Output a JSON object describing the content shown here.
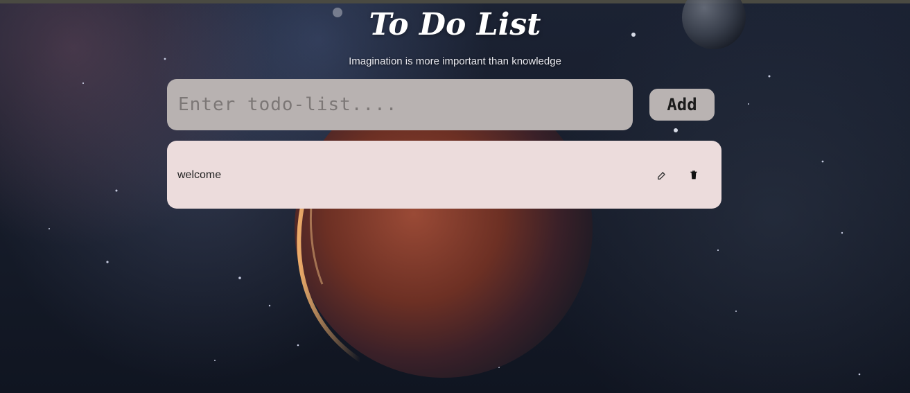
{
  "header": {
    "title": "To Do List",
    "subtitle": "Imagination is more important than knowledge"
  },
  "form": {
    "placeholder": "Enter todo-list....",
    "value": "",
    "add_label": "Add"
  },
  "todos": [
    {
      "text": "welcome",
      "edit_icon": "edit-icon",
      "delete_icon": "trash-icon"
    }
  ],
  "colors": {
    "input_background": "#b8b2b1",
    "button_background": "#b9b3b2",
    "todo_background": "#ecdcdc",
    "title_text": "#ffffff"
  }
}
